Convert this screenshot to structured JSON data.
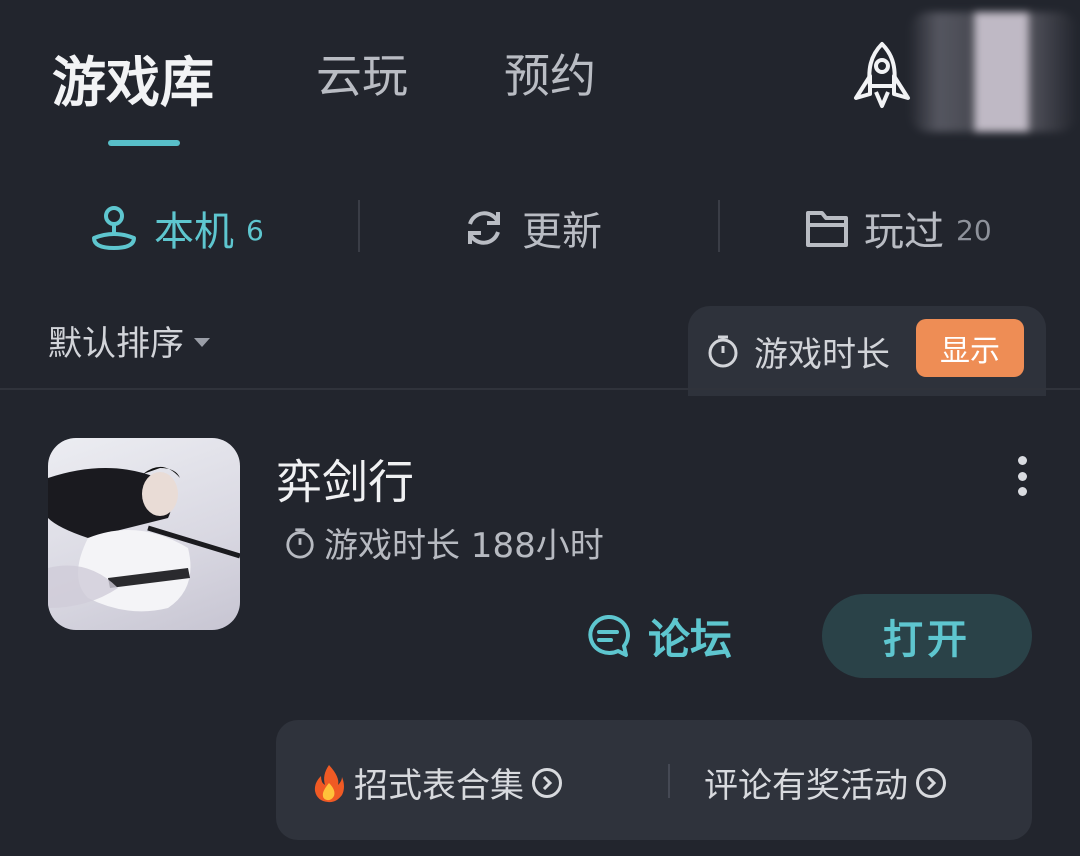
{
  "top_tabs": [
    {
      "label": "游戏库",
      "active": true
    },
    {
      "label": "云玩",
      "active": false
    },
    {
      "label": "预约",
      "active": false
    }
  ],
  "header_icons": [
    "rocket-icon",
    "avatar"
  ],
  "sub_tabs": [
    {
      "label": "本机",
      "count": "6",
      "icon": "joystick-icon",
      "active": true
    },
    {
      "label": "更新",
      "count": "",
      "icon": "refresh-icon",
      "active": false
    },
    {
      "label": "玩过",
      "count": "20",
      "icon": "folder-icon",
      "active": false
    }
  ],
  "sort": {
    "label": "默认排序"
  },
  "playtime_toggle": {
    "label": "游戏时长",
    "button": "显示"
  },
  "game": {
    "title": "弈剑行",
    "playtime": "游戏时长 188小时",
    "forum_label": "论坛",
    "open_label": "打开"
  },
  "extras": [
    {
      "label": "招式表合集",
      "icon": "fire-icon"
    },
    {
      "label": "评论有奖活动"
    }
  ],
  "colors": {
    "background": "#22252d",
    "accent": "#5ec6cf",
    "orange": "#ee8d55"
  }
}
